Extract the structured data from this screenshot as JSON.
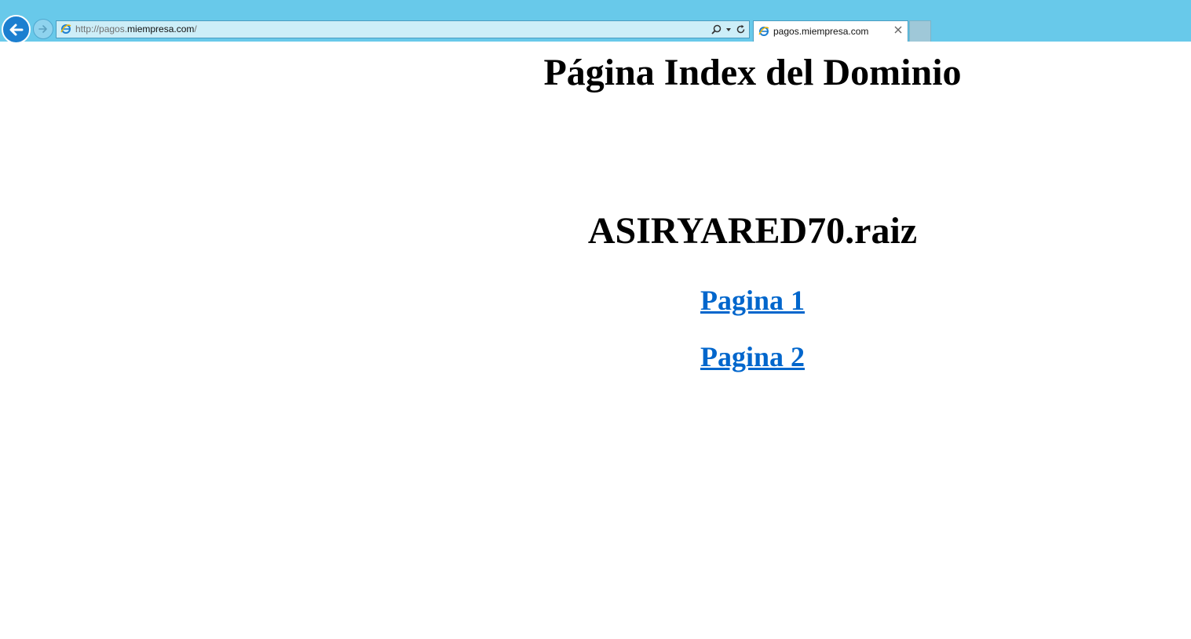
{
  "browser": {
    "url_prefix": "http://pagos.",
    "url_host": "miempresa.com",
    "url_suffix": "/",
    "tab_title": "pagos.miempresa.com",
    "bar_color": "#68c9ea",
    "icons": {
      "back": "back-arrow-icon",
      "forward": "forward-arrow-icon",
      "site": "ie-icon",
      "search": "search-icon",
      "dropdown": "dropdown-icon",
      "refresh": "refresh-icon",
      "close": "close-icon"
    }
  },
  "page": {
    "title": "Página Index del Dominio",
    "domain": "ASIRYARED70.raiz",
    "links": [
      {
        "label": "Pagina 1"
      },
      {
        "label": "Pagina 2"
      }
    ],
    "link_color": "#0066cc"
  }
}
